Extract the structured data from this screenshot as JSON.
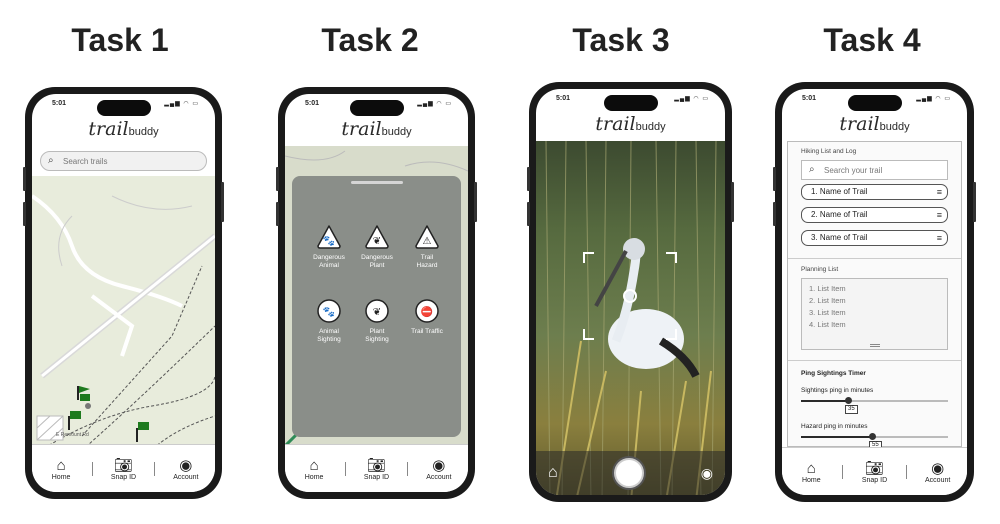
{
  "task_titles": [
    "Task 1",
    "Task 2",
    "Task 3",
    "Task 4"
  ],
  "status": {
    "time": "5:01",
    "icons": "signal wifi battery"
  },
  "logo": {
    "main": "trail",
    "sub": "buddy"
  },
  "tabs": {
    "home": "Home",
    "snap": "Snap ID",
    "account": "Account"
  },
  "task1": {
    "search_placeholder": "Search trails",
    "map_labels": [
      "E Remount Rd"
    ]
  },
  "task2": {
    "categories": [
      {
        "label_line1": "Dangerous",
        "label_line2": "Animal",
        "icon": "paw-warning-icon"
      },
      {
        "label_line1": "Dangerous",
        "label_line2": "Plant",
        "icon": "leaf-warning-icon"
      },
      {
        "label_line1": "Trail",
        "label_line2": "Hazard",
        "icon": "tree-warning-icon"
      },
      {
        "label_line1": "Animal",
        "label_line2": "Sighting",
        "icon": "paw-icon"
      },
      {
        "label_line1": "Plant",
        "label_line2": "Sighting",
        "icon": "leaf-icon"
      },
      {
        "label_line1": "Trail Traffic",
        "label_line2": "",
        "icon": "hiker-icon"
      }
    ]
  },
  "task4": {
    "hiking_title": "Hiking List and Log",
    "search_placeholder": "Search your trail",
    "trails": [
      "1. Name of Trail",
      "2. Name of Trail",
      "3. Name of Trail"
    ],
    "planning_title": "Planning List",
    "planning_items": [
      "1. List Item",
      "2. List Item",
      "3. List Item",
      "4. List Item"
    ],
    "timer_title": "Ping Sightings Timer",
    "sightings_label": "Sightings ping in minutes",
    "sightings_value": "35",
    "sightings_fraction": 0.3,
    "hazard_label": "Hazard ping in minutes",
    "hazard_value": "55",
    "hazard_fraction": 0.45
  },
  "colors": {
    "map_bg": "#e8ecdc",
    "flag": "#1e7a1e",
    "sheet": "#8a8e89"
  }
}
